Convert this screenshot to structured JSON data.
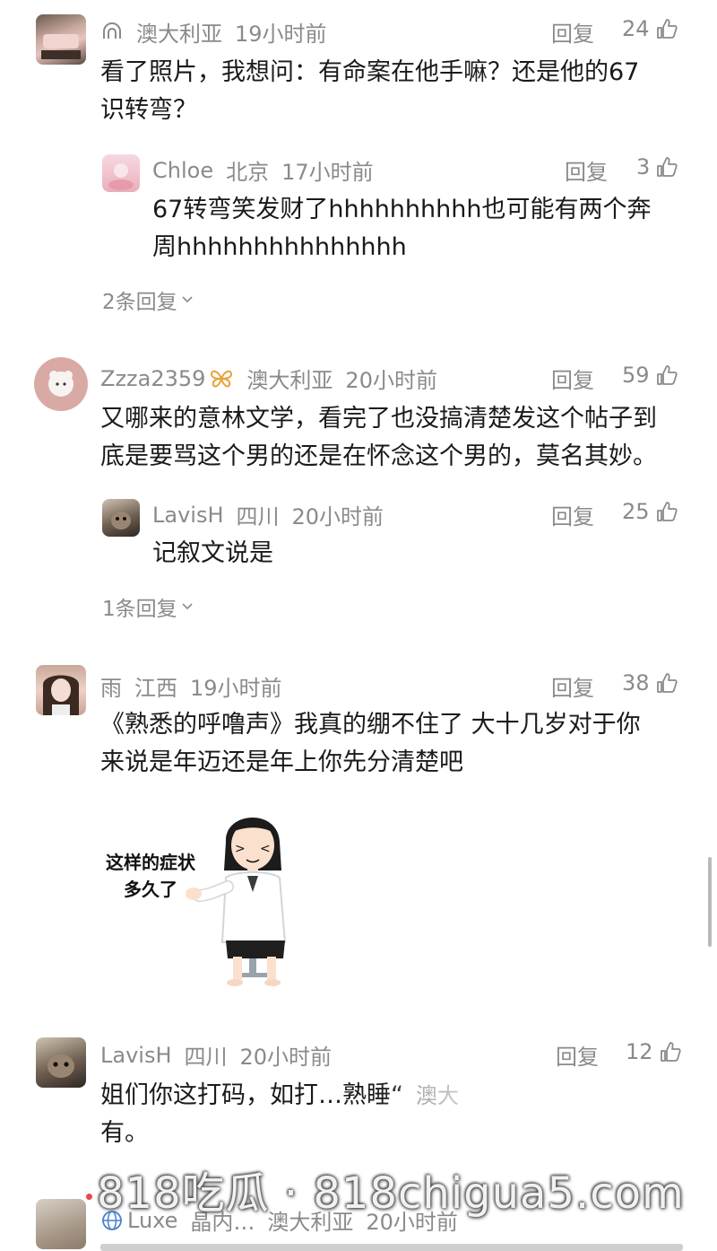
{
  "comments": [
    {
      "user": "",
      "location": "澳大利亚",
      "time": "19小时前",
      "reply": "回复",
      "likes": "24",
      "text1": "看了照片，我想问：有命案在他手嘛？还是他的67",
      "text2": "识转弯？",
      "sub": {
        "user": "Chloe",
        "location": "北京",
        "time": "17小时前",
        "reply": "回复",
        "likes": "3",
        "text1": "67转弯笑发财了hhhhhhhhhh也可能有两个奔",
        "text2": "周hhhhhhhhhhhhhhh"
      },
      "more": "2条回复"
    },
    {
      "user": "Zzza2359",
      "location": "澳大利亚",
      "time": "20小时前",
      "reply": "回复",
      "likes": "59",
      "text1": "又哪来的意林文学，看完了也没搞清楚发这个帖子到",
      "text2": "底是要骂这个男的还是在怀念这个男的，莫名其妙。",
      "sub": {
        "user": "LavisH",
        "location": "四川",
        "time": "20小时前",
        "reply": "回复",
        "likes": "25",
        "text1": "记叙文说是"
      },
      "more": "1条回复"
    },
    {
      "user": "雨",
      "location": "江西",
      "time": "19小时前",
      "reply": "回复",
      "likes": "38",
      "text1": "《熟悉的呼噜声》我真的绷不住了  大十几岁对于你",
      "text2": "来说是年迈还是年上你先分清楚吧",
      "sticker_line1": "这样的症状",
      "sticker_line2": "多久了"
    },
    {
      "user": "LavisH",
      "location": "四川",
      "time": "20小时前",
      "reply": "回复",
      "likes": "12",
      "text1": "姐们你这打码，如打…熟睡“",
      "text1_tail": "澳大",
      "text2": "有。"
    },
    {
      "user": "Luxe",
      "user_extra": "晶内…",
      "location": "澳大利亚",
      "time": "20小时前"
    }
  ],
  "watermark": "818吃瓜 · 818chigua5.com",
  "colors": {
    "meta": "#8a8a8a",
    "text": "#1a1a1a",
    "badge": "#e8a23a"
  }
}
